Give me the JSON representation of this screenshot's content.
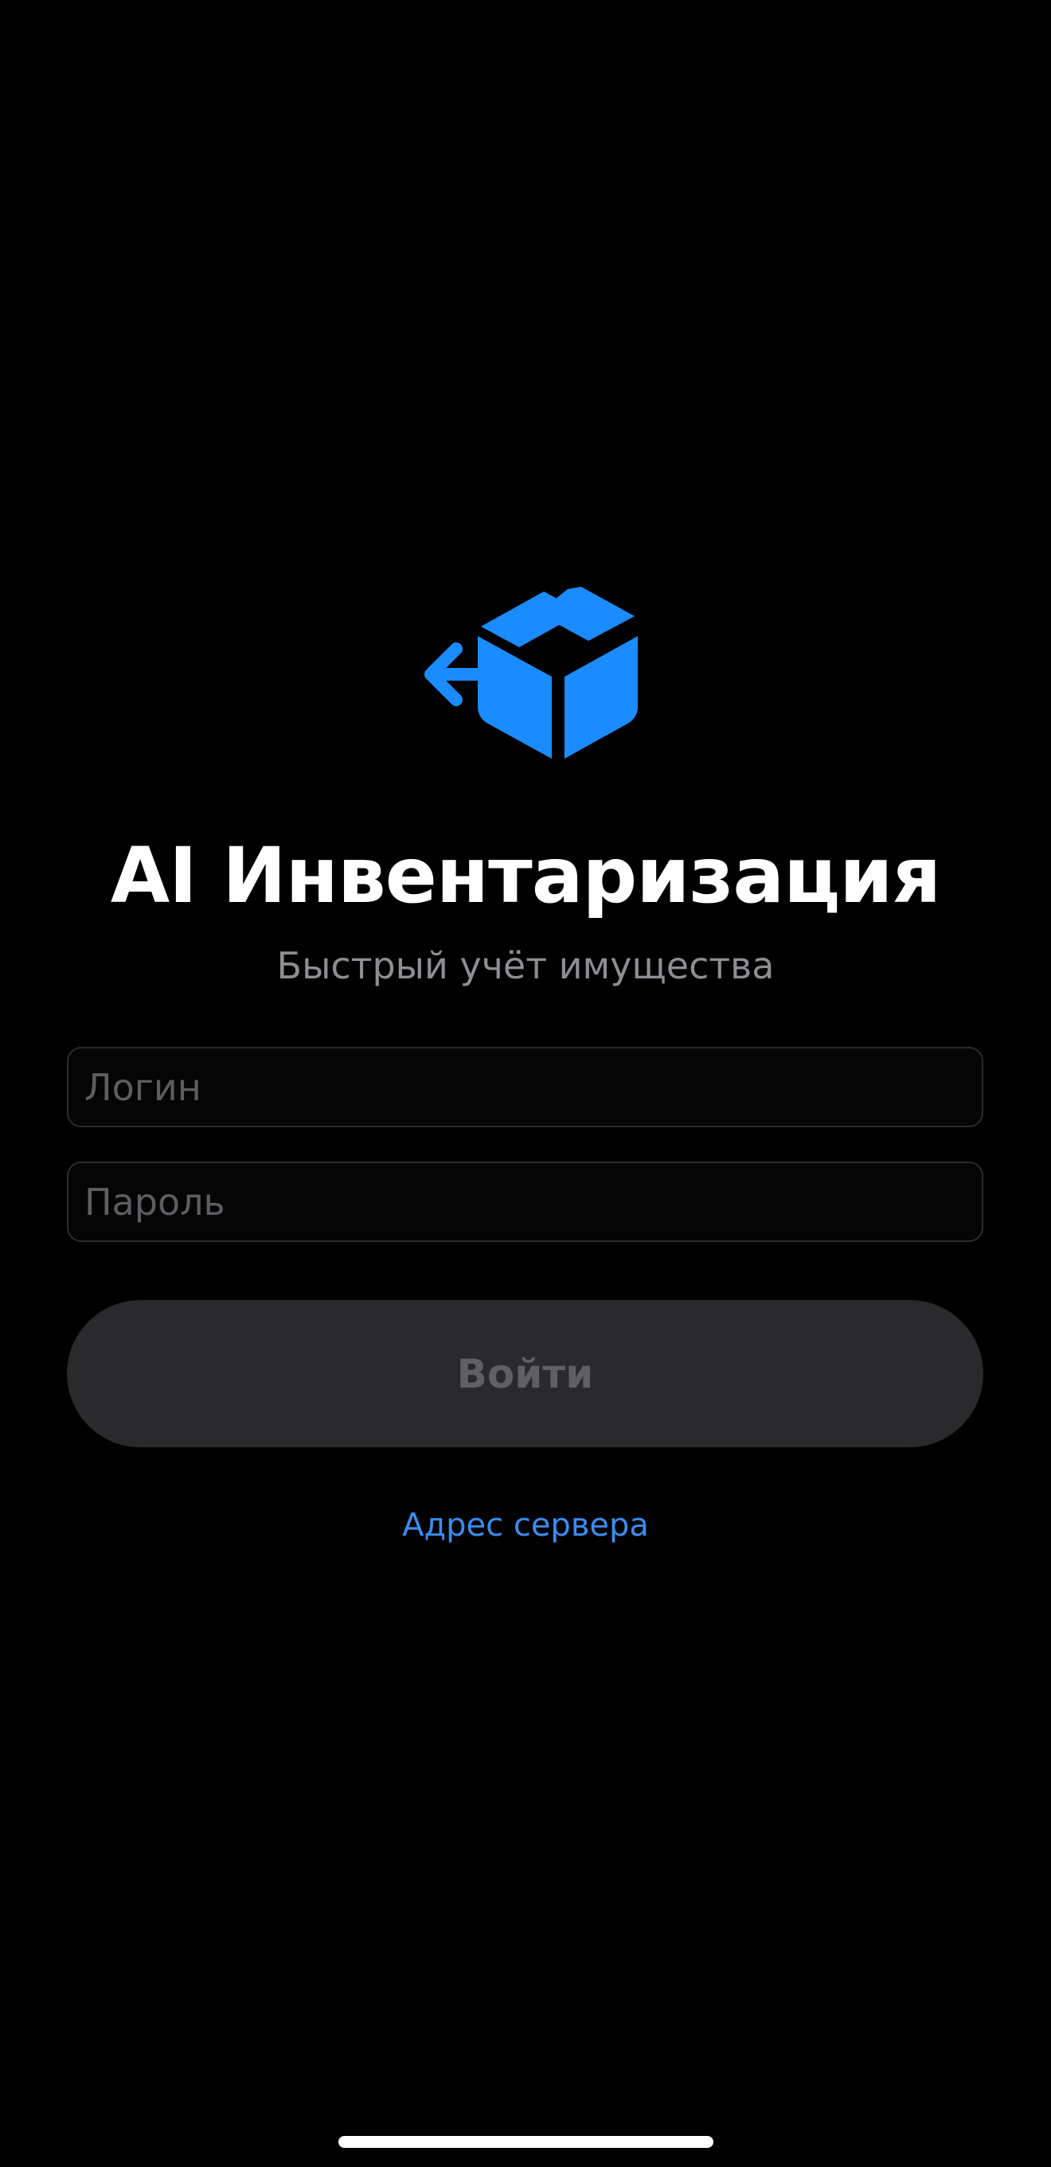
{
  "app": {
    "title": "AI Инвентаризация",
    "subtitle": "Быстрый учёт имущества",
    "logo_icon": "box-arrow-left-icon",
    "accent_color": "#1a8cff"
  },
  "form": {
    "login_placeholder": "Логин",
    "login_value": "",
    "password_placeholder": "Пароль",
    "password_value": "",
    "submit_label": "Войти",
    "submit_enabled": false
  },
  "links": {
    "server_address": "Адрес сервера"
  }
}
